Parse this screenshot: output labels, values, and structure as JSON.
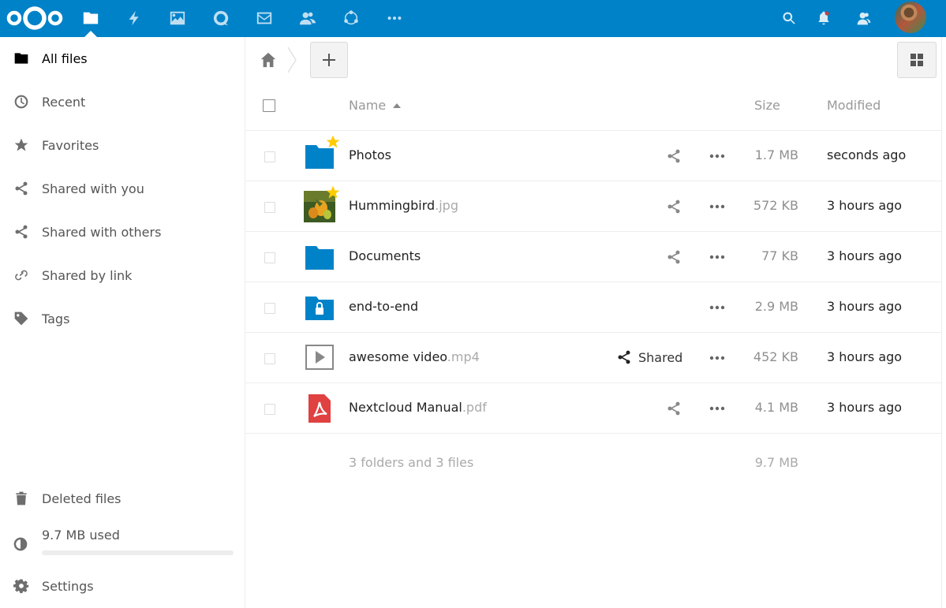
{
  "colors": {
    "brand": "#0082c9",
    "star": "#fc0",
    "pdf": "#e04141",
    "folder": "#0082c9"
  },
  "header": {
    "apps": [
      {
        "name": "files",
        "icon": "folder-icon"
      },
      {
        "name": "activity",
        "icon": "lightning-icon"
      },
      {
        "name": "gallery",
        "icon": "image-icon"
      },
      {
        "name": "talk",
        "icon": "chat-icon"
      },
      {
        "name": "mail",
        "icon": "mail-icon"
      },
      {
        "name": "contacts",
        "icon": "contacts-icon"
      },
      {
        "name": "circles",
        "icon": "circles-icon"
      },
      {
        "name": "more",
        "icon": "more-icon"
      }
    ],
    "right": [
      "search-icon",
      "bell-icon",
      "contacts-menu-icon",
      "avatar"
    ]
  },
  "sidebar": {
    "items": [
      {
        "label": "All files",
        "icon": "folder-icon"
      },
      {
        "label": "Recent",
        "icon": "clock-icon"
      },
      {
        "label": "Favorites",
        "icon": "star-icon"
      },
      {
        "label": "Shared with you",
        "icon": "share-icon"
      },
      {
        "label": "Shared with others",
        "icon": "share-icon"
      },
      {
        "label": "Shared by link",
        "icon": "link-icon"
      },
      {
        "label": "Tags",
        "icon": "tag-icon"
      }
    ],
    "deleted": {
      "label": "Deleted files",
      "icon": "trash-icon"
    },
    "quota": {
      "label": "9.7 MB used",
      "used_fraction": 0.0
    },
    "settings": {
      "label": "Settings",
      "icon": "gear-icon"
    }
  },
  "table": {
    "headers": {
      "name": "Name",
      "size": "Size",
      "modified": "Modified"
    },
    "rows": [
      {
        "name": "Photos",
        "ext": "",
        "size": "1.7 MB",
        "modified": "seconds ago",
        "type": "folder",
        "favorite": true,
        "shared_label": ""
      },
      {
        "name": "Hummingbird",
        "ext": ".jpg",
        "size": "572 KB",
        "modified": "3 hours ago",
        "type": "image",
        "favorite": true,
        "shared_label": ""
      },
      {
        "name": "Documents",
        "ext": "",
        "size": "77 KB",
        "modified": "3 hours ago",
        "type": "folder",
        "favorite": false,
        "shared_label": ""
      },
      {
        "name": "end-to-end",
        "ext": "",
        "size": "2.9 MB",
        "modified": "3 hours ago",
        "type": "encrypted-folder",
        "favorite": false,
        "shared_label": ""
      },
      {
        "name": "awesome video",
        "ext": ".mp4",
        "size": "452 KB",
        "modified": "3 hours ago",
        "type": "video",
        "favorite": false,
        "shared_label": "Shared"
      },
      {
        "name": "Nextcloud Manual",
        "ext": ".pdf",
        "size": "4.1 MB",
        "modified": "3 hours ago",
        "type": "pdf",
        "favorite": false,
        "shared_label": ""
      }
    ],
    "summary": {
      "label": "3 folders and 3 files",
      "size": "9.7 MB"
    }
  }
}
